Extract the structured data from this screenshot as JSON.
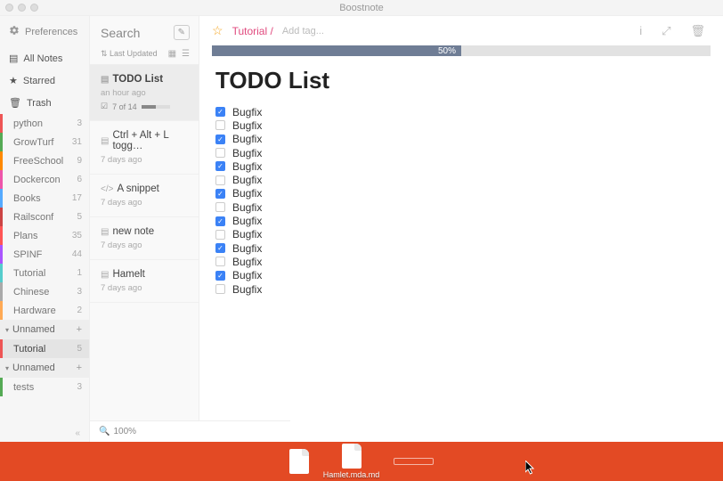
{
  "app_title": "Boostnote",
  "sidebar": {
    "preferences": "Preferences",
    "all_notes": "All Notes",
    "starred": "Starred",
    "trash": "Trash",
    "storages": [
      {
        "name": "Unnamed",
        "folders": [
          {
            "name": "python",
            "count": 3
          },
          {
            "name": "GrowTurf",
            "count": 31
          },
          {
            "name": "FreeSchool",
            "count": 9
          },
          {
            "name": "Dockercon",
            "count": 6
          },
          {
            "name": "Books",
            "count": 17
          },
          {
            "name": "Railsconf",
            "count": 5
          },
          {
            "name": "Plans",
            "count": 35
          },
          {
            "name": "SPINF",
            "count": 44
          },
          {
            "name": "Tutorial",
            "count": 1
          },
          {
            "name": "Chinese",
            "count": 3
          },
          {
            "name": "Hardware",
            "count": 2
          }
        ]
      },
      {
        "name": "Unnamed",
        "folders": [
          {
            "name": "Tutorial",
            "count": 5
          }
        ],
        "selected": 0
      },
      {
        "name": "Unnamed",
        "folders": [
          {
            "name": "tests",
            "count": 3
          }
        ]
      }
    ]
  },
  "notelist": {
    "search_label": "Search",
    "sort": "Last Updated",
    "notes": [
      {
        "type": "md",
        "title": "TODO List",
        "meta": "an hour ago",
        "progress": {
          "text": "7 of 14",
          "pct": 50
        },
        "selected": true
      },
      {
        "type": "md",
        "title": "Ctrl + Alt + L togg…",
        "meta": "7 days ago"
      },
      {
        "type": "snippet",
        "title": "A snippet",
        "meta": "7 days ago"
      },
      {
        "type": "md",
        "title": "new note",
        "meta": "7 days ago"
      },
      {
        "type": "md",
        "title": "Hamelt",
        "meta": "7 days ago"
      }
    ],
    "zoom": "100%"
  },
  "editor": {
    "star": "☆",
    "breadcrumb": "Tutorial /",
    "add_tag": "Add tag...",
    "progress_pct": "50%",
    "title": "TODO List",
    "checks": [
      {
        "label": "Bugfix",
        "checked": true
      },
      {
        "label": "Bugfix",
        "checked": false
      },
      {
        "label": "Bugfix",
        "checked": true
      },
      {
        "label": "Bugfix",
        "checked": false
      },
      {
        "label": "Bugfix",
        "checked": true
      },
      {
        "label": "Bugfix",
        "checked": false
      },
      {
        "label": "Bugfix",
        "checked": true
      },
      {
        "label": "Bugfix",
        "checked": false
      },
      {
        "label": "Bugfix",
        "checked": true
      },
      {
        "label": "Bugfix",
        "checked": false
      },
      {
        "label": "Bugfix",
        "checked": true
      },
      {
        "label": "Bugfix",
        "checked": false
      },
      {
        "label": "Bugfix",
        "checked": true
      },
      {
        "label": "Bugfix",
        "checked": false
      }
    ]
  },
  "dock": {
    "file_label": "Hamlet.mda.md"
  }
}
